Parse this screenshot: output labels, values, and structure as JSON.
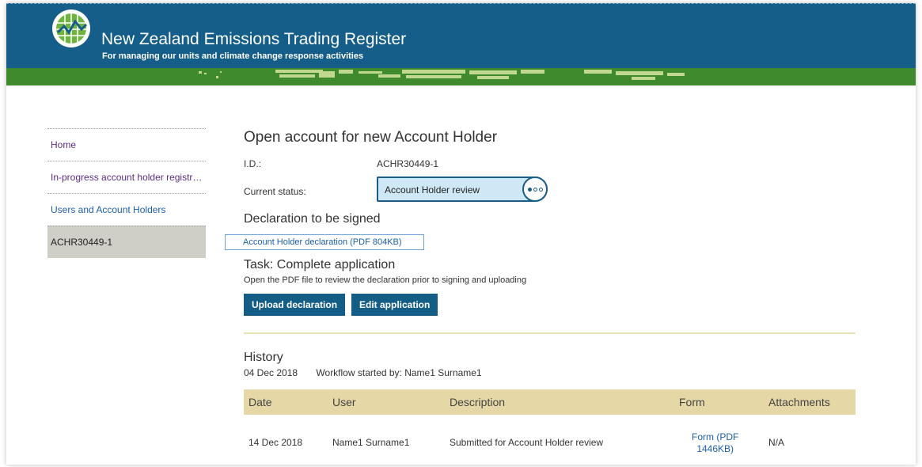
{
  "header": {
    "title": "New Zealand Emissions Trading Register",
    "subtitle": "For managing our units and climate change response activities",
    "logo_icon": "globe-emissions-logo-icon",
    "colors": {
      "header_bg": "#155e8a",
      "band_bg": "#3f8a2c"
    }
  },
  "sidebar": {
    "items": [
      {
        "label": "Home"
      },
      {
        "label": "In-progress account holder registrations"
      },
      {
        "label": "Users and Account Holders"
      },
      {
        "label": "ACHR30449-1"
      }
    ]
  },
  "main": {
    "title": "Open account for new Account Holder",
    "id_label": "I.D.:",
    "id_value": "ACHR30449-1",
    "status_label": "Current status:",
    "status_value": "Account Holder review",
    "status_icon": "more-dots-icon",
    "declaration_heading": "Declaration to be signed",
    "declaration_link": "Account Holder declaration (PDF 804KB)",
    "task_heading": "Task: Complete application",
    "task_subtext": "Open the PDF file to review the declaration prior to signing and uploading",
    "buttons": {
      "upload": "Upload declaration",
      "edit": "Edit application"
    }
  },
  "history": {
    "heading": "History",
    "start_date": "04 Dec 2018",
    "start_text": "Workflow started by: Name1 Surname1",
    "columns": [
      "Date",
      "User",
      "Description",
      "Form",
      "Attachments"
    ],
    "rows": [
      {
        "date": "14 Dec 2018",
        "user": "Name1 Surname1",
        "description": "Submitted for Account Holder review",
        "form_line1": "Form (PDF",
        "form_line2": "1446KB)",
        "attachments": "N/A"
      }
    ]
  }
}
